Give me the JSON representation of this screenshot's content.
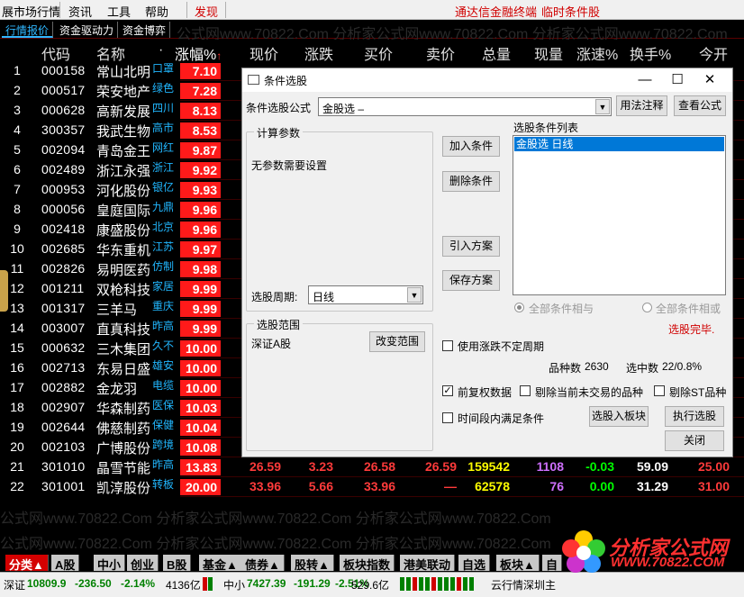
{
  "menu": {
    "items": [
      "展市场行情",
      "资讯",
      "工具",
      "帮助"
    ],
    "find": "发现",
    "right1": "通达信金融终端",
    "right2": "临时条件股"
  },
  "subtabs": [
    "行情报价",
    "资金驱动力",
    "资金博弈"
  ],
  "headers": {
    "code": "代码",
    "name": "名称",
    "dot": "·",
    "chg": "涨幅%",
    "sort_arrow": "↑",
    "price": "现价",
    "change": "涨跌",
    "bid": "买价",
    "ask": "卖价",
    "volume": "总量",
    "cur_vol": "现量",
    "speed": "涨速%",
    "turnover": "换手%",
    "open": "今开"
  },
  "watermark": "公式网www.70822.Com 分析家公式网www.70822.Com 分析家公式网www.70822.Com",
  "rows": [
    {
      "idx": "1",
      "code": "000158",
      "name": "常山北明",
      "tag": "口罩",
      "chg": "7.10"
    },
    {
      "idx": "2",
      "code": "000517",
      "name": "荣安地产",
      "tag": "绿色",
      "chg": "7.28"
    },
    {
      "idx": "3",
      "code": "000628",
      "name": "高新发展",
      "tag": "四川",
      "chg": "8.13"
    },
    {
      "idx": "4",
      "code": "300357",
      "name": "我武生物",
      "tag": "高市",
      "chg": "8.53"
    },
    {
      "idx": "5",
      "code": "002094",
      "name": "青岛金王",
      "tag": "网红",
      "chg": "9.87"
    },
    {
      "idx": "6",
      "code": "002489",
      "name": "浙江永强",
      "tag": "浙江",
      "chg": "9.92"
    },
    {
      "idx": "7",
      "code": "000953",
      "name": "河化股份",
      "tag": "银亿",
      "chg": "9.93"
    },
    {
      "idx": "8",
      "code": "000056",
      "name": "皇庭国际",
      "tag": "九鼎",
      "chg": "9.96"
    },
    {
      "idx": "9",
      "code": "002418",
      "name": "康盛股份",
      "tag": "北京",
      "chg": "9.96"
    },
    {
      "idx": "10",
      "code": "002685",
      "name": "华东重机",
      "tag": "江苏",
      "chg": "9.97"
    },
    {
      "idx": "11",
      "code": "002826",
      "name": "易明医药",
      "tag": "仿制",
      "chg": "9.98"
    },
    {
      "idx": "12",
      "code": "001211",
      "name": "双枪科技",
      "tag": "家居",
      "chg": "9.99"
    },
    {
      "idx": "13",
      "code": "001317",
      "name": "三羊马",
      "tag": "重庆",
      "chg": "9.99"
    },
    {
      "idx": "14",
      "code": "003007",
      "name": "直真科技",
      "tag": "昨高",
      "chg": "9.99"
    },
    {
      "idx": "15",
      "code": "000632",
      "name": "三木集团",
      "tag": "久不",
      "chg": "10.00"
    },
    {
      "idx": "16",
      "code": "002713",
      "name": "东易日盛",
      "tag": "雄安",
      "chg": "10.00"
    },
    {
      "idx": "17",
      "code": "002882",
      "name": "金龙羽",
      "tag": "电缆",
      "chg": "10.00"
    },
    {
      "idx": "18",
      "code": "002907",
      "name": "华森制药",
      "tag": "医保",
      "chg": "10.03"
    },
    {
      "idx": "19",
      "code": "002644",
      "name": "佛慈制药",
      "tag": "保健",
      "chg": "10.04"
    },
    {
      "idx": "20",
      "code": "002103",
      "name": "广博股份",
      "tag": "跨境",
      "chg": "10.08"
    },
    {
      "idx": "21",
      "code": "301010",
      "name": "晶雪节能",
      "tag": "昨高",
      "chg": "13.83",
      "price": "26.59",
      "change": "3.23",
      "bid": "26.58",
      "ask": "26.59",
      "volume": "159542",
      "cur_vol": "1108",
      "speed": "-0.03",
      "turnover": "59.09",
      "open": "25.00"
    },
    {
      "idx": "22",
      "code": "301001",
      "name": "凯淳股份",
      "tag": "转板",
      "chg": "20.00",
      "price": "33.96",
      "change": "5.66",
      "bid": "33.96",
      "ask": "—",
      "volume": "62578",
      "cur_vol": "76",
      "speed": "0.00",
      "turnover": "31.29",
      "open": "31.00"
    }
  ],
  "bottom_tabs": [
    "分类▲",
    "A股",
    "中小",
    "创业",
    "B股",
    "基金▲",
    "债券▲",
    "股转▲",
    "板块指数",
    "港美联动",
    "自选",
    "板块▲",
    "自"
  ],
  "status": {
    "sz_label": "深证",
    "sz_val": "10809.9",
    "sz_chg": "-236.50",
    "sz_pct": "-2.14%",
    "sz_amt": "4136亿",
    "zx_label": "中小",
    "zx_val": "7427.39",
    "zx_chg": "-191.29",
    "zx_pct": "-2.51%",
    "zx_amt": "529.6亿",
    "right": "云行情深圳主"
  },
  "logo": {
    "line1": "分析家公式网",
    "line2": "WWW.70822.COM"
  },
  "dialog": {
    "title": "条件选股",
    "formula_label": "条件选股公式",
    "formula_value": "金股选     –",
    "usage_button": "用法注释",
    "view_formula_button": "查看公式",
    "calc_group": "计算参数",
    "no_params": "无参数需要设置",
    "period_label": "选股周期:",
    "period_value": "日线",
    "add_button": "加入条件",
    "delete_button": "删除条件",
    "import_button": "引入方案",
    "save_button": "保存方案",
    "list_title": "选股条件列表",
    "list_items": [
      "金股选    日线"
    ],
    "radio_and": "全部条件相与",
    "radio_or": "全部条件相或",
    "done_text": "选股完毕.",
    "range_group": "选股范围",
    "range_value": "深证A股",
    "change_range_button": "改变范围",
    "cb_variable_period": "使用涨跌不定周期",
    "total_label": "品种数",
    "total_value": "2630",
    "hit_label": "选中数",
    "hit_value": "22/0.8%",
    "cb_fq": "前复权数据",
    "cb_exclude_untraded": "剔除当前未交易的品种",
    "cb_exclude_st": "剔除ST品种",
    "cb_time_range": "时间段内满足条件",
    "to_block_button": "选股入板块",
    "execute_button": "执行选股",
    "close_button": "关闭",
    "win_min": "—",
    "win_max": "☐",
    "win_close": "✕"
  }
}
